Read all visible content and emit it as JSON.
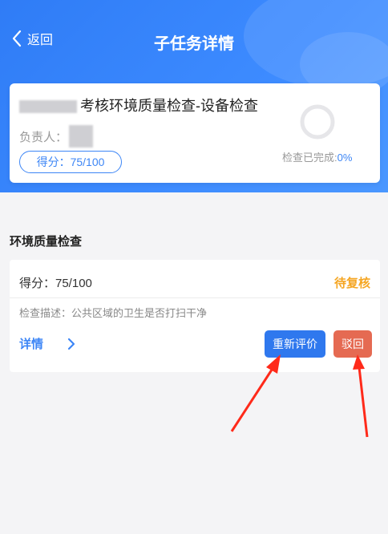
{
  "nav": {
    "back_label": "返回",
    "title": "子任务详情"
  },
  "task_card": {
    "title_suffix": "考核环境质量检查-设备检查",
    "responsible_label": "负责人：",
    "score_label": "得分：75/100",
    "progress_label": "检查已完成:",
    "progress_value": "0%"
  },
  "section": {
    "title": "环境质量检查"
  },
  "item": {
    "score_label": "得分：75/100",
    "status": "待复核",
    "description": "检查描述：公共区域的卫生是否打扫干净",
    "detail_label": "详情",
    "reevaluate_button": "重新评价",
    "reject_button": "驳回"
  },
  "colors": {
    "primary": "#3d86f6",
    "status_pending": "#f5a623",
    "reject": "#e56a52",
    "annotation_arrow": "#ff2a1a"
  },
  "icons": [
    "chevron-left-icon",
    "progress-ring-icon",
    "chevron-right-icon",
    "red-arrow-annotation"
  ]
}
